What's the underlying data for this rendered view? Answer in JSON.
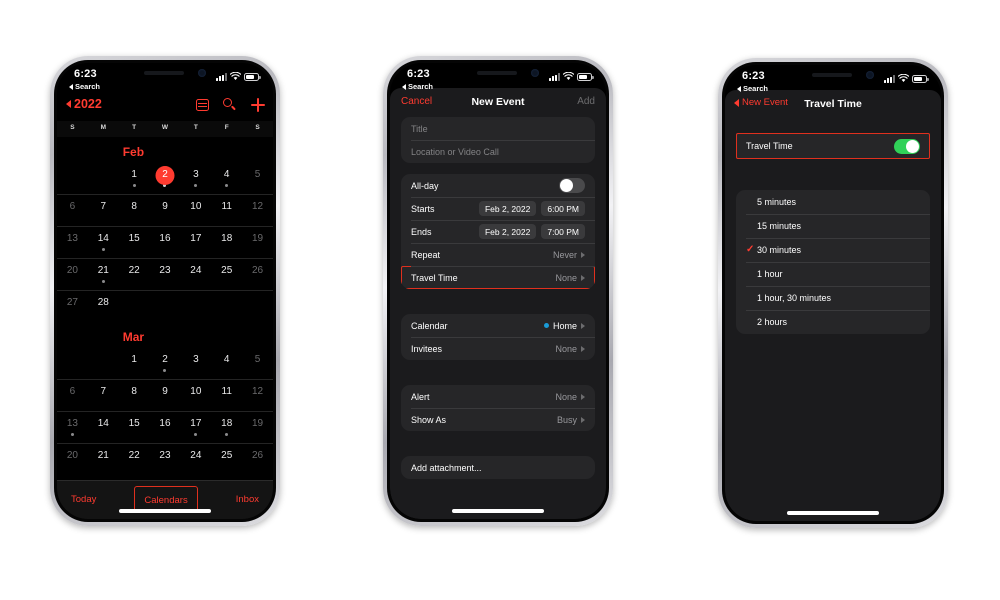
{
  "status_bar": {
    "time": "6:23",
    "back_label": "Search",
    "icons": [
      "signal-icon",
      "wifi-icon",
      "battery-icon"
    ]
  },
  "phone1": {
    "name": "calendar-year-screen",
    "nav": {
      "back_label": "2022",
      "icons": [
        "list-view-icon",
        "search-icon",
        "add-event-icon"
      ]
    },
    "weekday_headers": [
      "S",
      "M",
      "T",
      "W",
      "T",
      "F",
      "S"
    ],
    "months": [
      {
        "name": "Feb",
        "weeks": [
          [
            {
              "n": "",
              "empty": true
            },
            {
              "n": "",
              "empty": true
            },
            {
              "n": "1",
              "dot": true
            },
            {
              "n": "2",
              "selected": true,
              "dot": true
            },
            {
              "n": "3",
              "dot": true
            },
            {
              "n": "4",
              "dot": true
            },
            {
              "n": "5",
              "dim": true
            }
          ],
          [
            {
              "n": "6",
              "dim": true
            },
            {
              "n": "7"
            },
            {
              "n": "8"
            },
            {
              "n": "9"
            },
            {
              "n": "10"
            },
            {
              "n": "11"
            },
            {
              "n": "12",
              "dim": true
            }
          ],
          [
            {
              "n": "13",
              "dim": true
            },
            {
              "n": "14",
              "dot": true
            },
            {
              "n": "15"
            },
            {
              "n": "16"
            },
            {
              "n": "17"
            },
            {
              "n": "18"
            },
            {
              "n": "19",
              "dim": true
            }
          ],
          [
            {
              "n": "20",
              "dim": true
            },
            {
              "n": "21",
              "dot": true
            },
            {
              "n": "22"
            },
            {
              "n": "23"
            },
            {
              "n": "24"
            },
            {
              "n": "25"
            },
            {
              "n": "26",
              "dim": true
            }
          ],
          [
            {
              "n": "27",
              "dim": true
            },
            {
              "n": "28"
            },
            {
              "n": "",
              "empty": true
            },
            {
              "n": "",
              "empty": true
            },
            {
              "n": "",
              "empty": true
            },
            {
              "n": "",
              "empty": true
            },
            {
              "n": "",
              "empty": true
            }
          ]
        ]
      },
      {
        "name": "Mar",
        "weeks": [
          [
            {
              "n": "",
              "empty": true
            },
            {
              "n": "",
              "empty": true
            },
            {
              "n": "1"
            },
            {
              "n": "2",
              "dot": true
            },
            {
              "n": "3"
            },
            {
              "n": "4"
            },
            {
              "n": "5",
              "dim": true
            }
          ],
          [
            {
              "n": "6",
              "dim": true
            },
            {
              "n": "7"
            },
            {
              "n": "8"
            },
            {
              "n": "9"
            },
            {
              "n": "10"
            },
            {
              "n": "11"
            },
            {
              "n": "12",
              "dim": true
            }
          ],
          [
            {
              "n": "13",
              "dim": true,
              "dot": true
            },
            {
              "n": "14"
            },
            {
              "n": "15"
            },
            {
              "n": "16"
            },
            {
              "n": "17",
              "dot": true
            },
            {
              "n": "18",
              "dot": true
            },
            {
              "n": "19",
              "dim": true
            }
          ],
          [
            {
              "n": "20",
              "dim": true
            },
            {
              "n": "21"
            },
            {
              "n": "22"
            },
            {
              "n": "23"
            },
            {
              "n": "24"
            },
            {
              "n": "25"
            },
            {
              "n": "26",
              "dim": true
            }
          ]
        ]
      }
    ],
    "tabbar": {
      "today": "Today",
      "calendars": "Calendars",
      "inbox": "Inbox",
      "highlighted": "Calendars"
    }
  },
  "phone2": {
    "name": "new-event-screen",
    "nav": {
      "cancel": "Cancel",
      "title": "New Event",
      "add": "Add"
    },
    "fields": {
      "title_placeholder": "Title",
      "location_placeholder": "Location or Video Call"
    },
    "schedule": {
      "allday_label": "All-day",
      "allday_on": false,
      "starts_label": "Starts",
      "starts_date": "Feb 2, 2022",
      "starts_time": "6:00 PM",
      "ends_label": "Ends",
      "ends_date": "Feb 2, 2022",
      "ends_time": "7:00 PM",
      "repeat_label": "Repeat",
      "repeat_value": "Never",
      "travel_label": "Travel Time",
      "travel_value": "None"
    },
    "calendar_group": {
      "calendar_label": "Calendar",
      "calendar_value": "Home",
      "calendar_color": "#1a9bd7",
      "invitees_label": "Invitees",
      "invitees_value": "None"
    },
    "alert_group": {
      "alert_label": "Alert",
      "alert_value": "None",
      "showas_label": "Show As",
      "showas_value": "Busy"
    },
    "attachment_label": "Add attachment..."
  },
  "phone3": {
    "name": "travel-time-screen",
    "nav": {
      "back": "New Event",
      "title": "Travel Time"
    },
    "toggle": {
      "label": "Travel Time",
      "on": true,
      "color": "#30d158"
    },
    "options": [
      {
        "label": "5 minutes",
        "checked": false
      },
      {
        "label": "15 minutes",
        "checked": false
      },
      {
        "label": "30 minutes",
        "checked": true
      },
      {
        "label": "1 hour",
        "checked": false
      },
      {
        "label": "1 hour, 30 minutes",
        "checked": false
      },
      {
        "label": "2 hours",
        "checked": false
      }
    ],
    "check_glyph": "✓"
  },
  "highlight_color": "#e0301e",
  "accent_color": "#ff3b30"
}
